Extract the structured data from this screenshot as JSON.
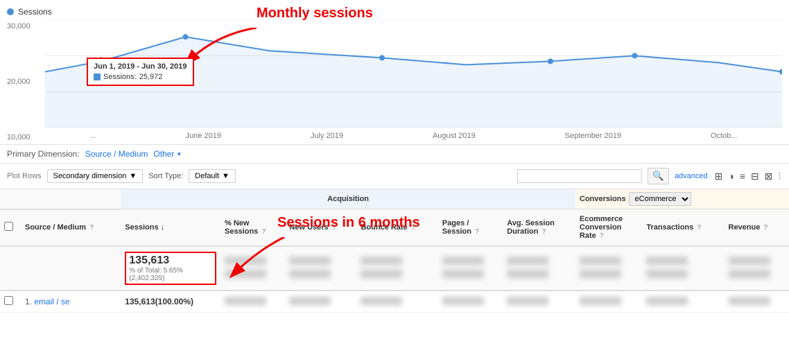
{
  "chart": {
    "legend_label": "Sessions",
    "y_labels": [
      "30,000",
      "20,000",
      "10,000"
    ],
    "x_labels": [
      "...",
      "June 2019",
      "July 2019",
      "August 2019",
      "September 2019",
      "Octob..."
    ],
    "tooltip": {
      "date_range": "Jun 1, 2019 - Jun 30, 2019",
      "metric": "Sessions:",
      "value": "25,972"
    },
    "annotation_monthly": "Monthly sessions",
    "annotation_6months": "Sessions in 6 months"
  },
  "controls": {
    "primary_dim_label": "Primary Dimension:",
    "primary_dim_value": "Source / Medium",
    "other_label": "Other"
  },
  "toolbar": {
    "plot_rows": "Plot Rows",
    "secondary_dim": "Secondary dimension",
    "sort_type_label": "Sort Type:",
    "sort_default": "Default",
    "advanced_label": "advanced",
    "search_placeholder": ""
  },
  "table": {
    "checkbox_col": "",
    "source_medium_col": "Source / Medium",
    "acquisition_label": "Acquisition",
    "conversions_label": "Conversions",
    "ecommerce_option": "eCommerce",
    "columns": {
      "sessions": "Sessions",
      "pct_new_sessions": "% New Sessions",
      "new_users": "New Users",
      "bounce_rate": "Bounce Rate",
      "pages_session": "Pages / Session",
      "avg_session_duration": "Avg. Session Duration",
      "ecommerce_conversion_rate": "Ecommerce Conversion Rate",
      "transactions": "Transactions",
      "revenue": "Revenue"
    },
    "total_row": {
      "sessions": "135,613",
      "pct_total": "% of Total: 5.65%",
      "total_value": "(2,402,329)"
    },
    "data_rows": [
      {
        "num": "1.",
        "source_medium": "email / se",
        "sessions": "135,613(100.00%)"
      }
    ]
  }
}
